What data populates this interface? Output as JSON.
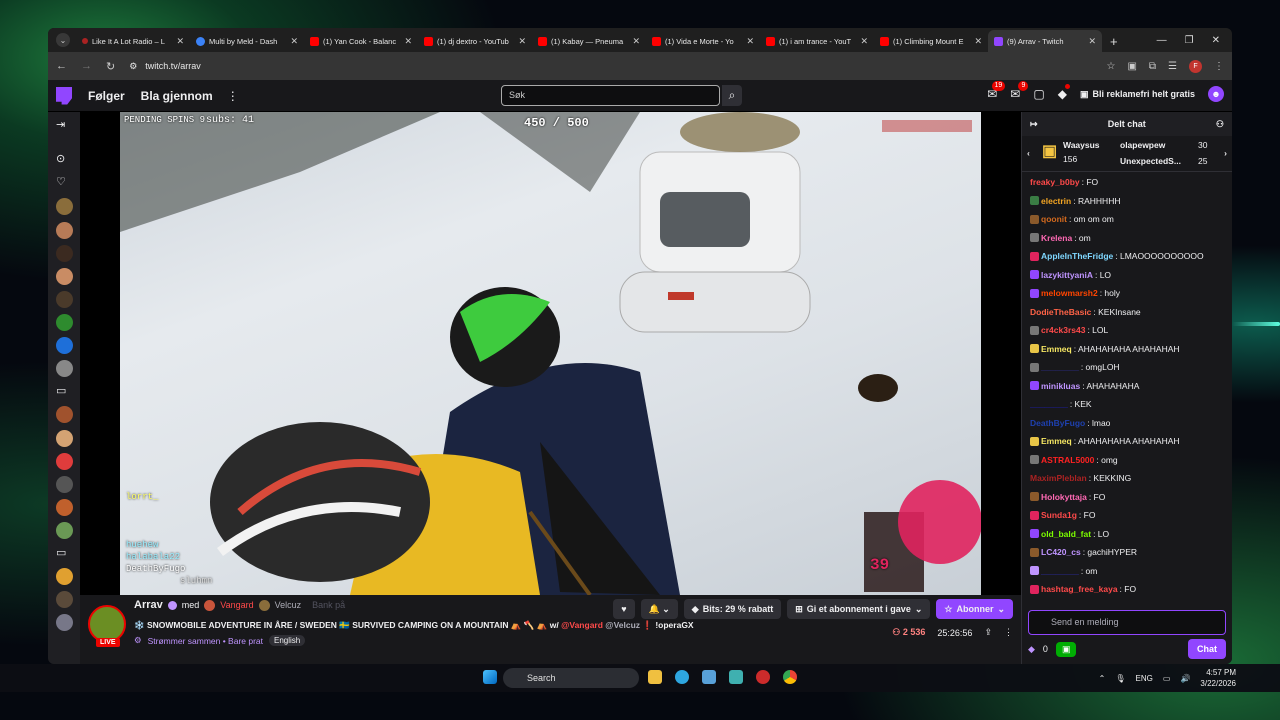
{
  "browser": {
    "tabs": [
      {
        "title": "Like It A Lot Radio – L",
        "fav": "dot"
      },
      {
        "title": "Multi by Meld - Dash",
        "fav": "meld"
      },
      {
        "title": "(1) Yan Cook - Balanc",
        "fav": "yt"
      },
      {
        "title": "(1) dj dextro - YouTub",
        "fav": "yt"
      },
      {
        "title": "(1) Kabay — Pneuma",
        "fav": "yt"
      },
      {
        "title": "(1) Vida e Morte - Yo",
        "fav": "yt"
      },
      {
        "title": "(1) i am trance - YouT",
        "fav": "yt"
      },
      {
        "title": "(1) Climbing Mount E",
        "fav": "yt"
      },
      {
        "title": "(9) Arrav - Twitch",
        "fav": "tw"
      }
    ],
    "url": "twitch.tv/arrav",
    "profile_initial": "F"
  },
  "twitch_nav": {
    "following": "Følger",
    "browse": "Bla gjennom",
    "search_placeholder": "Søk",
    "inbox_badge": "19",
    "whisper_badge": "9",
    "adfree": "Bli reklamefri helt gratis"
  },
  "video_overlay": {
    "pending_spins": "PENDING SPINS 9",
    "subs": "subs: 41",
    "goal": "450 / 500",
    "overlay_names": [
      "lorrt_",
      "huehew",
      "halabala22",
      "DeathByFugo",
      "sluhmn"
    ],
    "alert_number": "39"
  },
  "channel": {
    "name": "Arrav",
    "with": "med",
    "collab1": "Vangard",
    "collab2": "Velcuz",
    "collab3": "Bank på",
    "title": "❄️ SNOWMOBILE ADVENTURE IN ÅRE / SWEDEN 🇸🇪 SURVIVED CAMPING ON A MOUNTAIN ⛺ 🪓 ⛺ w/ ",
    "title_m1": "@Vangard",
    "title_m2": " @Velcuz",
    "title_end": " ❗ !operaGX",
    "sharing": "Strømmer sammen • Bare prat",
    "tag": "English",
    "live": "LIVE",
    "bits": "Bits: 29 % rabatt",
    "gift": "Gi et abonnement i gave",
    "subscribe": "Abonner",
    "viewers": "2 536",
    "uptime": "25:26:56"
  },
  "chat": {
    "header": "Delt chat",
    "leaderboard": [
      {
        "name": "Waaysus",
        "value": "156"
      },
      {
        "name": "olapewpew",
        "value": "30"
      },
      {
        "name": "UnexpectedS...",
        "value": "25"
      }
    ],
    "messages": [
      {
        "user": "freaky_b0by",
        "color": "#ff4a4a",
        "text": ": FO",
        "badge": ""
      },
      {
        "user": "electrin",
        "color": "#f5a623",
        "text": ": RAHHHHH",
        "badge": "#3a7d44"
      },
      {
        "user": "qoonit",
        "color": "#d2691e",
        "text": ": om om om",
        "badge": "#8b5a2b"
      },
      {
        "user": "Krelena",
        "color": "#ff69b4",
        "text": ": om",
        "badge": "#777777"
      },
      {
        "user": "AppleInTheFridge",
        "color": "#7fd7ff",
        "text": ": LMAOOOOOOOOOO",
        "badge": "#e0245e"
      },
      {
        "user": "lazykittyaniA",
        "color": "#bf94ff",
        "text": ": LO",
        "badge": "#9146ff"
      },
      {
        "user": "melowmarsh2",
        "color": "#ff4500",
        "text": ": holy",
        "badge": "#9146ff"
      },
      {
        "user": "DodieTheBasic",
        "color": "#ff6347",
        "text": ": KEKInsane",
        "badge": ""
      },
      {
        "user": "cr4ck3rs43",
        "color": "#ff4a4a",
        "text": ": LOL",
        "badge": "#777777"
      },
      {
        "user": "Emmeq",
        "color": "#f5e663",
        "text": ": AHAHAHAHA AHAHAHAH",
        "badge": "#e8c547"
      },
      {
        "user": "________",
        "color": "#3333aa",
        "text": ": omgLOH",
        "badge": "#777777"
      },
      {
        "user": "minikluas",
        "color": "#bf94ff",
        "text": ": AHAHAHAHA",
        "badge": "#9146ff"
      },
      {
        "user": "________",
        "color": "#2222dd",
        "text": ": KEK",
        "badge": ""
      },
      {
        "user": "DeathByFugo",
        "color": "#1e40af",
        "text": ": lmao",
        "badge": ""
      },
      {
        "user": "Emmeq",
        "color": "#f5e663",
        "text": ": AHAHAHAHA AHAHAHAH",
        "badge": "#e8c547"
      },
      {
        "user": "ASTRAL5000",
        "color": "#ff2222",
        "text": ": omg",
        "badge": "#777777"
      },
      {
        "user": "MaximPleblan",
        "color": "#aa2222",
        "text": ": KEKKING",
        "badge": ""
      },
      {
        "user": "Holokyttaja",
        "color": "#ff69b4",
        "text": ": FO",
        "badge": "#8b5a2b"
      },
      {
        "user": "Sunda1g",
        "color": "#ff4a4a",
        "text": ": FO",
        "badge": "#e0245e"
      },
      {
        "user": "old_bald_fat",
        "color": "#7cfc00",
        "text": ": LO",
        "badge": "#9146ff"
      },
      {
        "user": "LC420_cs",
        "color": "#bf94ff",
        "text": ": gachiHYPER",
        "badge": "#8b5a2b"
      },
      {
        "user": "________",
        "color": "#3333cc",
        "text": ": om",
        "badge": "#bf94ff"
      },
      {
        "user": "hashtag_free_kaya",
        "color": "#ff4a4a",
        "text": ": FO",
        "badge": "#e0245e"
      }
    ],
    "input_placeholder": "Send en melding",
    "points": "0",
    "send": "Chat"
  },
  "taskbar": {
    "search": "Search",
    "lang": "ENG",
    "time": "4:57 PM",
    "date": "3/22/2026"
  }
}
